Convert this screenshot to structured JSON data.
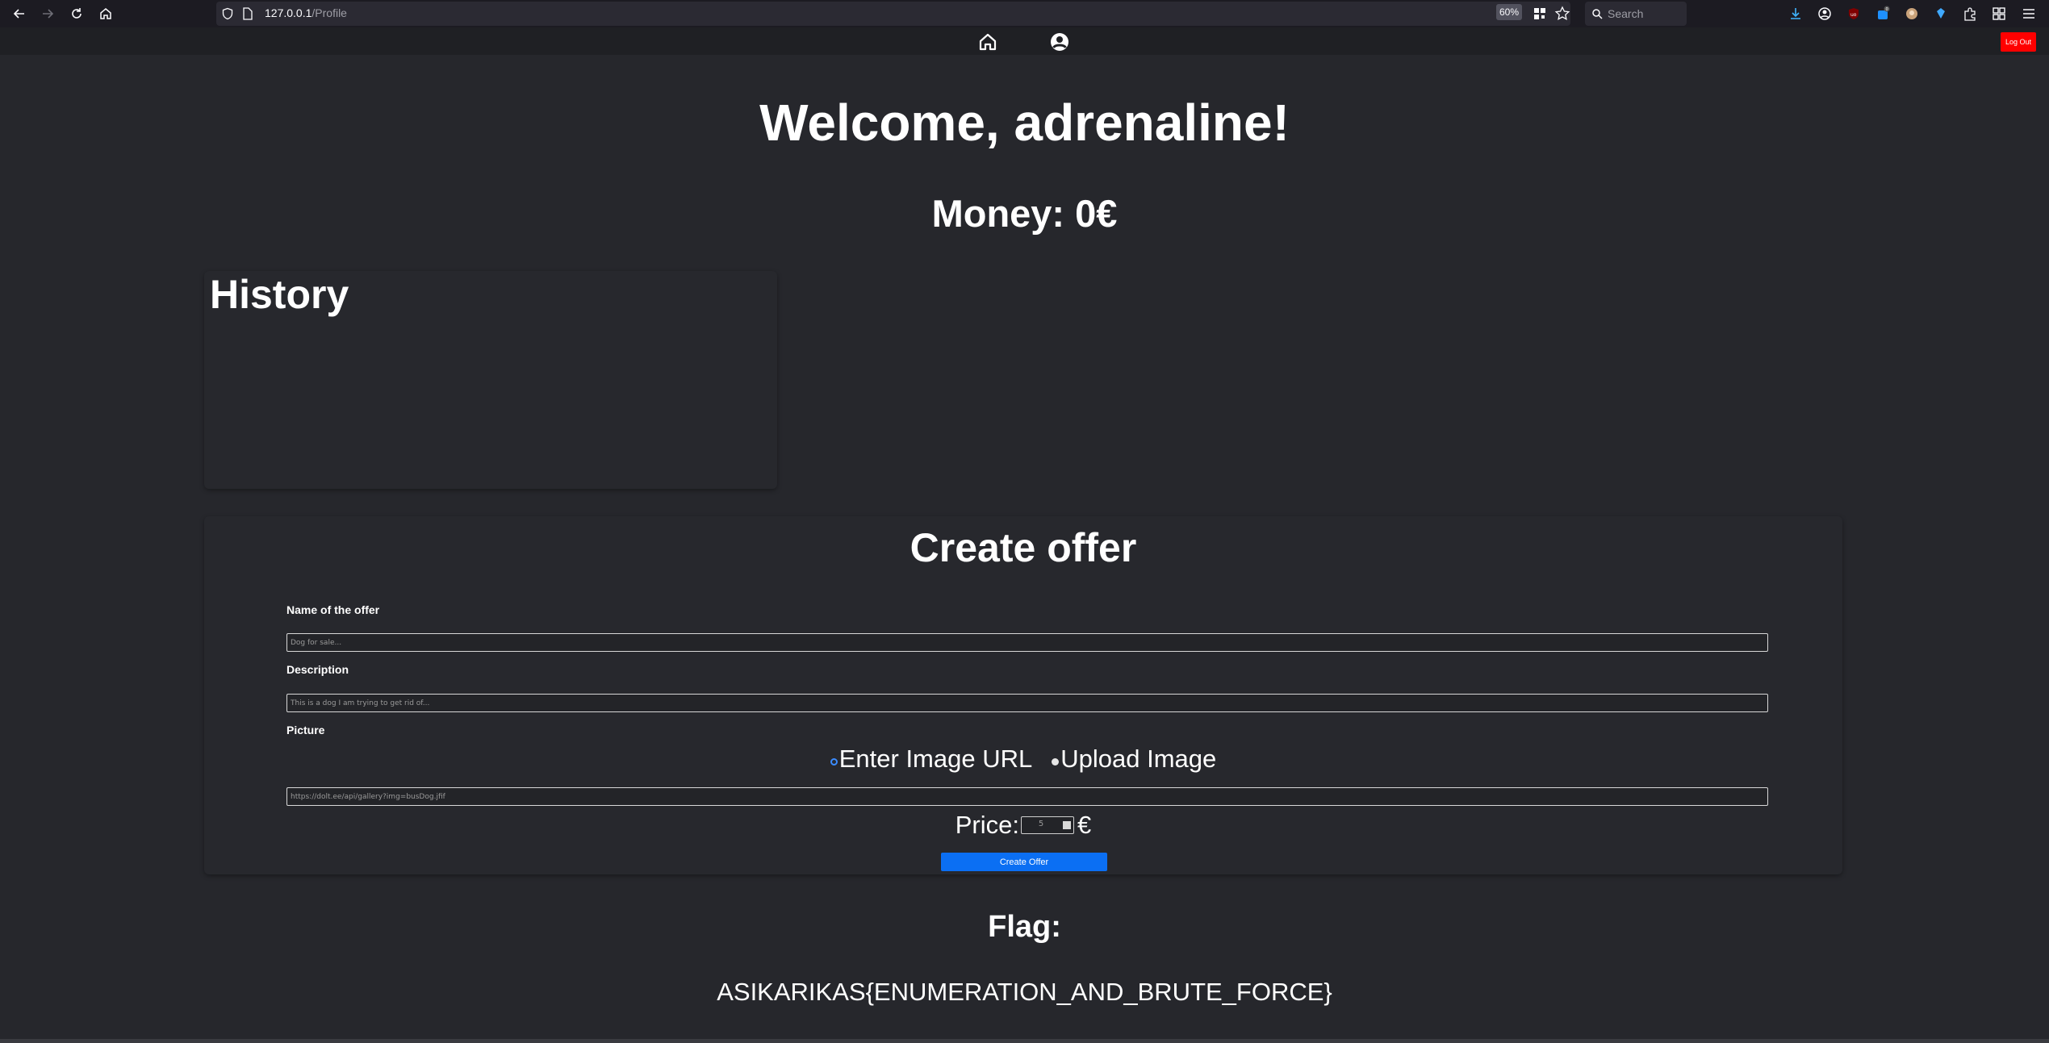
{
  "browser": {
    "url_host": "127.0.0.1",
    "url_path": "/Profile",
    "zoom": "60%",
    "search_placeholder": "Search"
  },
  "site_nav": {
    "logout_label": "Log Out"
  },
  "profile": {
    "welcome": "Welcome, adrenaline!",
    "money": "Money: 0€"
  },
  "history": {
    "title": "History"
  },
  "create_offer": {
    "title": "Create offer",
    "name_label": "Name of the offer",
    "name_placeholder": "Dog for sale...",
    "description_label": "Description",
    "description_placeholder": "This is a dog I am trying to get rid of...",
    "picture_label": "Picture",
    "radio_url_label": "Enter Image URL",
    "radio_upload_label": "Upload Image",
    "url_placeholder": "https://dolt.ee/api/gallery?img=busDog.jfif",
    "price_label": "Price:",
    "price_value": "5",
    "currency": "€",
    "submit_label": "Create Offer"
  },
  "flag": {
    "title": "Flag:",
    "value": "ASIKARIKAS{ENUMERATION_AND_BRUTE_FORCE}"
  },
  "colors": {
    "page_bg": "#26272c",
    "logout_bg": "#ff0000",
    "primary_button": "#0b6ff3",
    "radio_accent": "#3b8cff"
  }
}
